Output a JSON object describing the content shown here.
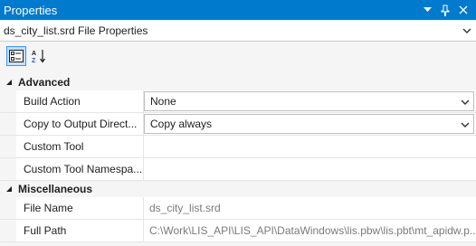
{
  "window": {
    "title": "Properties"
  },
  "object_selector": {
    "label": "ds_city_list.srd File Properties"
  },
  "toolbar": {
    "categorized_icon": "categorized-icon",
    "alphabetical_icon": "alphabetical-sort-icon"
  },
  "categories": [
    {
      "name": "Advanced",
      "properties": [
        {
          "name": "Build Action",
          "value": "None",
          "dropdown": true
        },
        {
          "name": "Copy to Output Direct...",
          "value": "Copy always",
          "dropdown": true
        },
        {
          "name": "Custom Tool",
          "value": ""
        },
        {
          "name": "Custom Tool Namespa...",
          "value": ""
        }
      ]
    },
    {
      "name": "Miscellaneous",
      "properties": [
        {
          "name": "File Name",
          "value": "ds_city_list.srd",
          "readonly": true
        },
        {
          "name": "Full Path",
          "value": "C:\\Work\\LIS_API\\LIS_API\\DataWindows\\lis.pbw\\lis.pbt\\mt_apidw.p...",
          "readonly": true
        }
      ]
    }
  ],
  "colors": {
    "titlebar": "#007acc",
    "selection_border": "#3399ff"
  }
}
